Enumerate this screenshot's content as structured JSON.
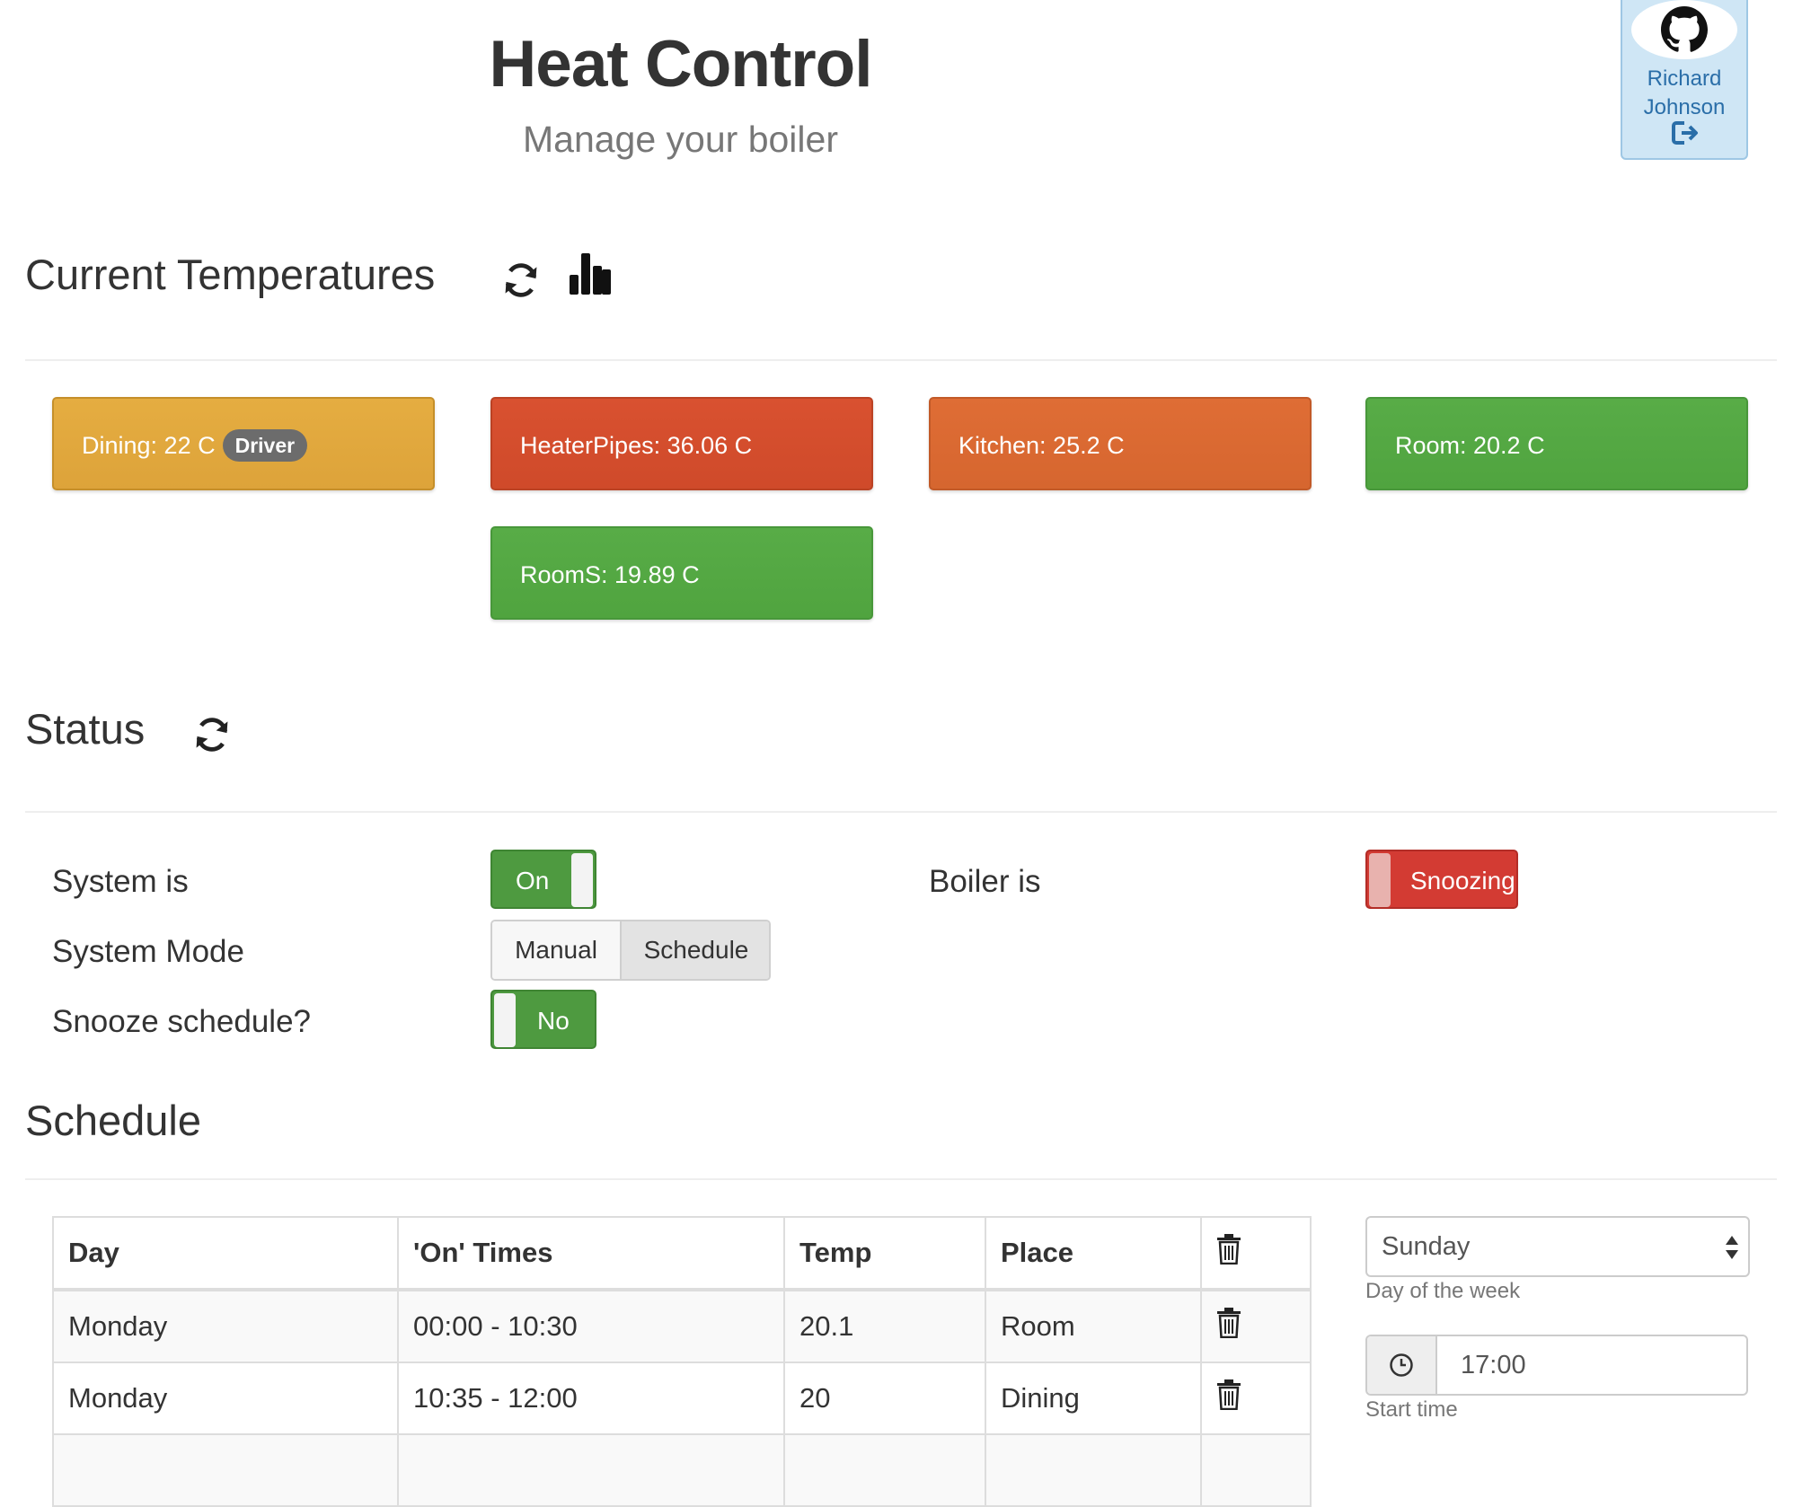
{
  "header": {
    "title": "Heat Control",
    "subtitle": "Manage your boiler"
  },
  "user": {
    "first_name": "Richard",
    "last_name": "Johnson",
    "avatar_icon": "github-icon",
    "logout_icon": "logout-icon"
  },
  "temperatures": {
    "heading": "Current Temperatures",
    "refresh_icon": "refresh-icon",
    "chart_icon": "bar-chart-icon",
    "tiles": [
      {
        "label": "Dining: 22 C",
        "badge": "Driver",
        "color": "#dea53b"
      },
      {
        "label": "HeaterPipes: 36.06 C",
        "color": "#d24e2d"
      },
      {
        "label": "Kitchen: 25.2 C",
        "color": "#d96832"
      },
      {
        "label": "Room: 20.2 C",
        "color": "#53a842"
      },
      {
        "label": "RoomS: 19.89 C",
        "color": "#53a842"
      }
    ]
  },
  "status": {
    "heading": "Status",
    "refresh_icon": "refresh-icon",
    "system_label": "System is",
    "system_value": "On",
    "mode_label": "System Mode",
    "mode_options": [
      "Manual",
      "Schedule"
    ],
    "mode_selected": "Schedule",
    "snooze_label": "Snooze schedule?",
    "snooze_value": "No",
    "boiler_label": "Boiler is",
    "boiler_value": "Snoozing"
  },
  "schedule": {
    "heading": "Schedule",
    "columns": [
      "Day",
      "'On' Times",
      "Temp",
      "Place"
    ],
    "delete_icon": "trash-icon",
    "rows": [
      {
        "day": "Monday",
        "times": "00:00 - 10:30",
        "temp": "20.1",
        "place": "Room"
      },
      {
        "day": "Monday",
        "times": "10:35 - 12:00",
        "temp": "20",
        "place": "Dining"
      }
    ]
  },
  "form": {
    "day_value": "Sunday",
    "day_help": "Day of the week",
    "time_value": "17:00",
    "time_help": "Start time",
    "clock_icon": "clock-icon"
  },
  "colors": {
    "green": "#4e9a40",
    "red": "#d33b33",
    "link": "#2a6ea8"
  }
}
